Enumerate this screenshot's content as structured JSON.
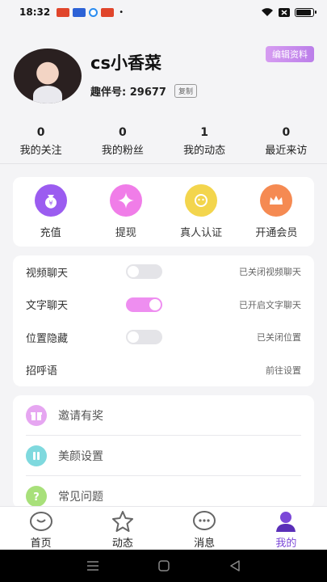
{
  "status_bar": {
    "time": "18:32",
    "dot": "•"
  },
  "profile": {
    "nickname": "cs小香菜",
    "uid_text": "趣伴号: 29677",
    "copy_label": "复制",
    "edit_label": "编辑资料"
  },
  "stats": [
    {
      "value": "0",
      "label": "我的关注"
    },
    {
      "value": "0",
      "label": "我的粉丝"
    },
    {
      "value": "1",
      "label": "我的动态"
    },
    {
      "value": "0",
      "label": "最近来访"
    }
  ],
  "quick_actions": [
    {
      "label": "充值",
      "icon": "money-bag-icon",
      "color": "#9b5cf0"
    },
    {
      "label": "提现",
      "icon": "sparkle-icon",
      "color": "#f07de8"
    },
    {
      "label": "真人认证",
      "icon": "face-icon",
      "color": "#f3d54d"
    },
    {
      "label": "开通会员",
      "icon": "crown-icon",
      "color": "#f58a52"
    }
  ],
  "settings": [
    {
      "label": "视频聊天",
      "toggle": false,
      "status": "已关闭视频聊天"
    },
    {
      "label": "文字聊天",
      "toggle": true,
      "status": "已开启文字聊天"
    },
    {
      "label": "位置隐藏",
      "toggle": false,
      "status": "已关闭位置"
    },
    {
      "label": "招呼语",
      "status": "前往设置"
    }
  ],
  "menu": [
    {
      "label": "邀请有奖",
      "icon": "gift-icon",
      "color": "#e6a6f1"
    },
    {
      "label": "美颜设置",
      "icon": "beauty-icon",
      "color": "#7fd9de"
    },
    {
      "label": "常见问题",
      "icon": "question-icon",
      "color": "#a8e07a"
    }
  ],
  "tabs": [
    {
      "label": "首页",
      "icon": "home-icon",
      "active": false
    },
    {
      "label": "动态",
      "icon": "star-icon",
      "active": false
    },
    {
      "label": "消息",
      "icon": "message-icon",
      "active": false
    },
    {
      "label": "我的",
      "icon": "profile-icon",
      "active": true
    }
  ],
  "colors": {
    "accent": "#7c48d8",
    "toggle_on": "#ee8ef0"
  }
}
